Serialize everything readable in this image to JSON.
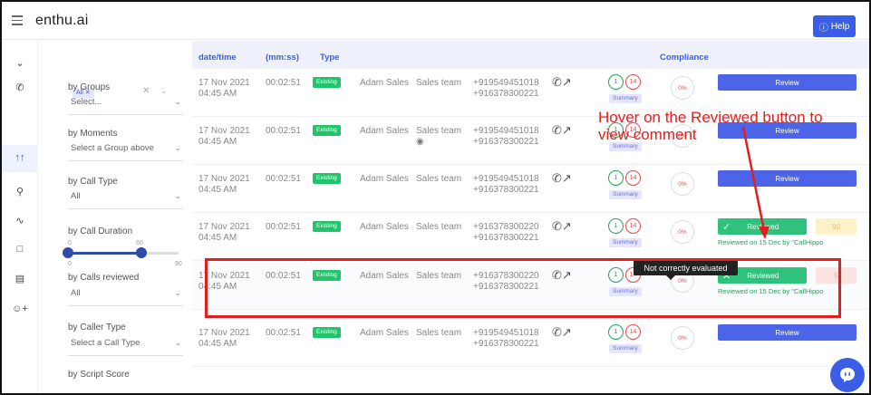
{
  "app": {
    "brand": "enthu.ai",
    "help_label": "Help"
  },
  "filters": {
    "chip_label": "All",
    "groups": {
      "label": "by Groups",
      "value": "Select..."
    },
    "moments": {
      "label": "by Moments",
      "value": "Select a Group above"
    },
    "call_type": {
      "label": "by Call Type",
      "value": "All"
    },
    "call_duration": {
      "label": "by Call Duration",
      "min_label": "0",
      "max_label": "90",
      "mid_label": "60",
      "range": [
        0,
        60
      ],
      "max": 90
    },
    "calls_reviewed": {
      "label": "by Calls reviewed",
      "value": "All"
    },
    "caller_type": {
      "label": "by Caller Type",
      "value": "Select a Call Type"
    },
    "script_score": {
      "label": "by Script Score"
    }
  },
  "table": {
    "headers": {
      "datetime": "date/time",
      "duration": "(mm:ss)",
      "type": "Type",
      "compliance": "Compliance"
    },
    "rows": [
      {
        "date": "17 Nov 2021",
        "time": "04:45 AM",
        "duration": "00:02:51",
        "badge": "Existing",
        "agent": "Adam Sales",
        "team": "Sales team",
        "phone1": "+919549451018",
        "phone2": "+916378300221",
        "c1": "1",
        "c2": "14",
        "summary": "Summary",
        "pct": "0%",
        "action": "Review"
      },
      {
        "date": "17 Nov 2021",
        "time": "04:45 AM",
        "duration": "00:02:51",
        "badge": "Existing",
        "agent": "Adam Sales",
        "team": "Sales team",
        "phone1": "+919549451018",
        "phone2": "+916378300221",
        "c1": "1",
        "c2": "14",
        "summary": "Summary",
        "pct": "0%",
        "action": "Review"
      },
      {
        "date": "17 Nov 2021",
        "time": "04:45 AM",
        "duration": "00:02:51",
        "badge": "Existing",
        "agent": "Adam Sales",
        "team": "Sales team",
        "phone1": "+919549451018",
        "phone2": "+916378300221",
        "c1": "1",
        "c2": "14",
        "summary": "Summary",
        "pct": "0%",
        "action": "Review"
      },
      {
        "date": "17 Nov 2021",
        "time": "04:45 AM",
        "duration": "00:02:51",
        "badge": "Existing",
        "agent": "Adam Sales",
        "team": "Sales team",
        "phone1": "+916378300220",
        "phone2": "+916378300221",
        "c1": "1",
        "c2": "14",
        "summary": "Summary",
        "pct": "0%",
        "action": "Reviewed",
        "score": "90",
        "note": "Reviewed on 15 Dec by \"CallHippo"
      },
      {
        "date": "17 Nov 2021",
        "time": "04:45 AM",
        "duration": "00:02:51",
        "badge": "Existing",
        "agent": "Adam Sales",
        "team": "Sales team",
        "phone1": "+916378300220",
        "phone2": "+916378300221",
        "c1": "1",
        "c2": "14",
        "summary": "Summary",
        "pct": "0%",
        "action": "Reviewed",
        "score": "5",
        "note": "Reviewed on 15 Dec by \"CallHippo"
      },
      {
        "date": "17 Nov 2021",
        "time": "04:45 AM",
        "duration": "00:02:51",
        "badge": "Existing",
        "agent": "Adam Sales",
        "team": "Sales team",
        "phone1": "+919549451018",
        "phone2": "+916378300221",
        "c1": "1",
        "c2": "14",
        "summary": "Summary",
        "pct": "0%",
        "action": "Review"
      }
    ]
  },
  "tooltip": "Not correctly evaluated",
  "annotation": {
    "text": "Hover on the Reviewed button to view comment",
    "color": "#e41e1e"
  },
  "colors": {
    "accent": "#3b5ee8",
    "reviewed": "#2fc27c",
    "annotation": "#e41e1e"
  }
}
